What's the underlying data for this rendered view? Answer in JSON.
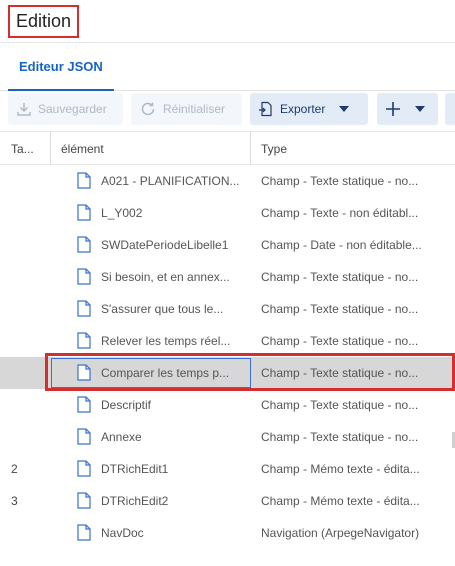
{
  "window": {
    "title": "Edition",
    "accent_color": "#1565c0",
    "highlight_color": "#d32f2f"
  },
  "tabs": [
    {
      "label": "Editeur JSON",
      "active": true
    }
  ],
  "toolbar": {
    "save_label": "Sauvegarder",
    "reset_label": "Réinitialiser",
    "export_label": "Exporter"
  },
  "table": {
    "columns": [
      "Ta...",
      "élément",
      "Type"
    ],
    "rows": [
      {
        "num": "",
        "element": "A021 - PLANIFICATION...",
        "type": "Champ - Texte statique - no..."
      },
      {
        "num": "",
        "element": "L_Y002",
        "type": "Champ - Texte - non éditabl..."
      },
      {
        "num": "",
        "element": "SWDatePeriodeLibelle1",
        "type": "Champ - Date - non éditable..."
      },
      {
        "num": "",
        "element": "Si besoin, et en annex...",
        "type": "Champ - Texte statique - no..."
      },
      {
        "num": "",
        "element": "S'assurer que tous le...",
        "type": "Champ - Texte statique - no..."
      },
      {
        "num": "",
        "element": "Relever les temps réel...",
        "type": "Champ - Texte statique - no..."
      },
      {
        "num": "",
        "element": "Comparer les temps p...",
        "type": "Champ - Texte statique - no...",
        "selected": true
      },
      {
        "num": "",
        "element": "Descriptif",
        "type": "Champ - Texte statique - no..."
      },
      {
        "num": "",
        "element": "Annexe",
        "type": "Champ - Texte statique - no..."
      },
      {
        "num": "2",
        "element": "DTRichEdit1",
        "type": "Champ - Mémo texte - édita..."
      },
      {
        "num": "3",
        "element": "DTRichEdit2",
        "type": "Champ - Mémo texte - édita..."
      },
      {
        "num": "",
        "element": "NavDoc",
        "type": "Navigation (ArpegeNavigator)"
      }
    ]
  }
}
